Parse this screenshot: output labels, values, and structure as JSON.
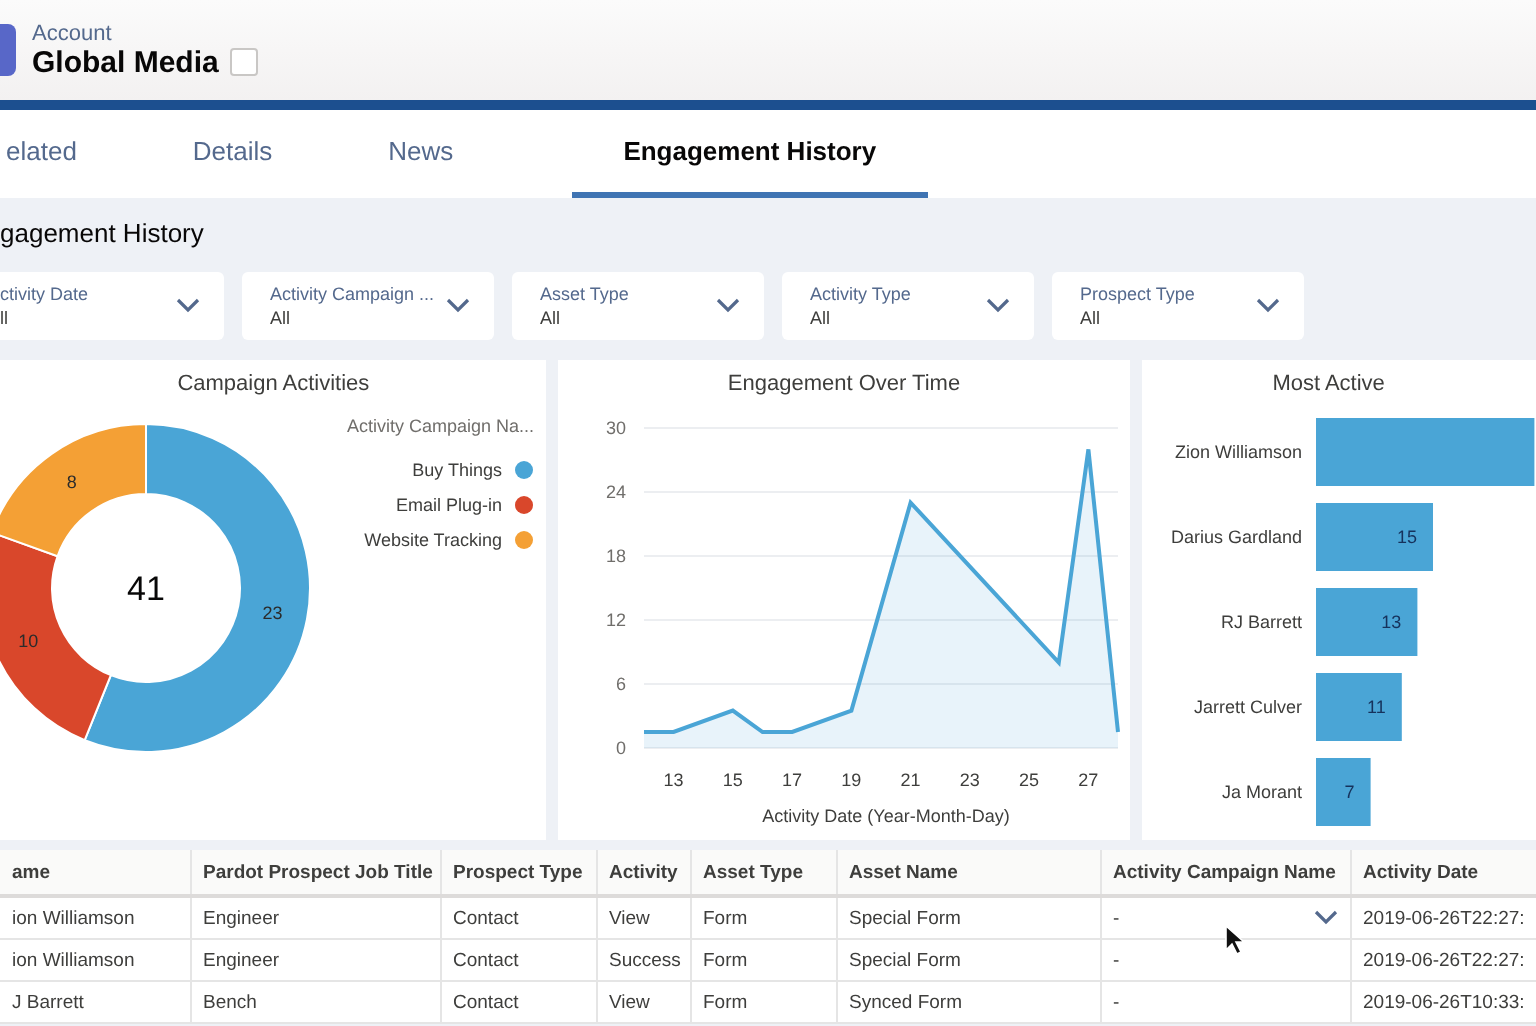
{
  "header": {
    "object_type": "Account",
    "title": "Global Media"
  },
  "tabs": [
    {
      "label": "elated",
      "selected": false
    },
    {
      "label": "Details",
      "selected": false
    },
    {
      "label": "News",
      "selected": false
    },
    {
      "label": "Engagement History",
      "selected": true
    }
  ],
  "section_title": "gagement History",
  "filters": [
    {
      "label": "ctivity Date",
      "value": "ll"
    },
    {
      "label": "Activity Campaign ...",
      "value": "All"
    },
    {
      "label": "Asset Type",
      "value": "All"
    },
    {
      "label": "Activity Type",
      "value": "All"
    },
    {
      "label": "Prospect Type",
      "value": "All"
    }
  ],
  "campaign_activities": {
    "title": "Campaign Activities",
    "total": "41",
    "chart_data": {
      "type": "donut",
      "categories": [
        "Buy Things",
        "Email Plug-in",
        "Website Tracking"
      ],
      "values": [
        23,
        10,
        8
      ],
      "colors": [
        "#4aa5d6",
        "#d9472b",
        "#f4a035"
      ],
      "data_labels": true,
      "legend": true
    },
    "legend_title": "Activity Campaign Na..."
  },
  "engagement_over_time": {
    "title": "Engagement Over Time",
    "chart_data": {
      "type": "area",
      "xlabel": "Activity Date (Year-Month-Day)",
      "x": [
        12,
        13,
        15,
        16,
        17,
        19,
        21,
        26,
        27,
        28
      ],
      "series": [
        {
          "color": "#4aa5d6",
          "values": [
            1.5,
            1.5,
            3.5,
            1.5,
            1.5,
            3.5,
            23,
            8,
            28,
            1.5
          ]
        }
      ],
      "xlim": [
        12,
        28
      ],
      "ylim": [
        0,
        30
      ],
      "grid": true,
      "xticks": [
        13,
        15,
        17,
        19,
        21,
        23,
        25,
        27
      ],
      "yticks": [
        0,
        6,
        12,
        18,
        24,
        30
      ]
    }
  },
  "most_active": {
    "title": "Most Active",
    "chart_data": {
      "type": "bar",
      "orientation": "horizontal",
      "categories": [
        "Zion Williamson",
        "Darius Gardland",
        "RJ Barrett",
        "Jarrett Culver",
        "Ja Morant"
      ],
      "values": [
        28,
        15,
        13,
        11,
        7
      ],
      "value_labels": [
        null,
        "15",
        "13",
        "11",
        "7"
      ]
    }
  },
  "table": {
    "columns": [
      "ame",
      "Pardot Prospect Job Title",
      "Prospect Type",
      "Activity",
      "Asset Type",
      "Asset Name",
      "Activity Campaign Name",
      "Activity Date"
    ],
    "rows": [
      {
        "cells": [
          "ion Williamson",
          "Engineer",
          "Contact",
          "View",
          "Form",
          "Special Form",
          "-",
          "2019-06-26T22:27:"
        ],
        "hovered": true
      },
      {
        "cells": [
          "ion Williamson",
          "Engineer",
          "Contact",
          "Success",
          "Form",
          "Special Form",
          "-",
          "2019-06-26T22:27:"
        ],
        "hovered": false
      },
      {
        "cells": [
          "J Barrett",
          "Bench",
          "Contact",
          "View",
          "Form",
          "Synced Form",
          "-",
          "2019-06-26T10:33:"
        ],
        "hovered": false
      }
    ]
  }
}
